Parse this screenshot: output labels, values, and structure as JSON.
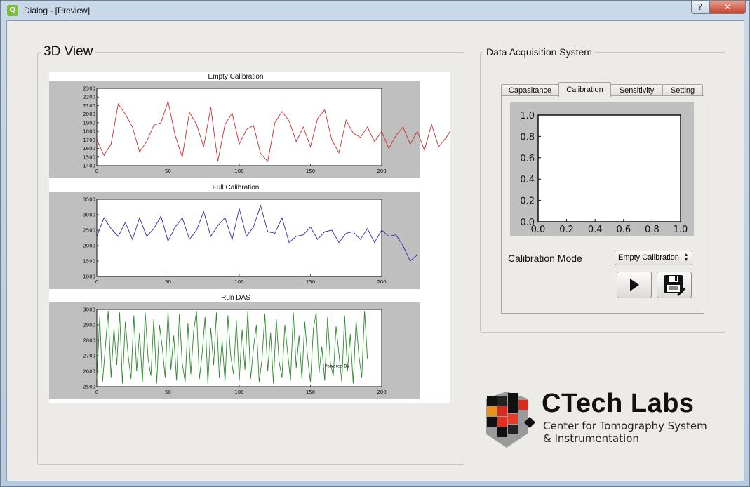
{
  "window": {
    "title": "Dialog - [Preview]",
    "help_glyph": "?",
    "close_glyph": "✕",
    "app_icon_glyph": "Q"
  },
  "view3d": {
    "group_title": "3D View",
    "charts": [
      {
        "title": "Empty Calibration",
        "ytick_labels": [
          "1400",
          "1500",
          "1600",
          "1700",
          "1800",
          "1900",
          "2000",
          "2100",
          "2200",
          "2300"
        ],
        "xtick_labels": [
          "0",
          "50",
          "100",
          "150",
          "200"
        ]
      },
      {
        "title": "Full Calibration",
        "ytick_labels": [
          "1000",
          "1500",
          "2000",
          "2500",
          "3000",
          "3500"
        ],
        "xtick_labels": [
          "0",
          "50",
          "100",
          "150",
          "200"
        ]
      },
      {
        "title": "Run DAS",
        "ytick_labels": [
          "2500",
          "2600",
          "2700",
          "2800",
          "2900",
          "3000"
        ],
        "xtick_labels": [
          "0",
          "50",
          "100",
          "150",
          "200"
        ],
        "annotation": "Powered By"
      }
    ]
  },
  "das": {
    "group_title": "Data Acquisition System",
    "tabs": [
      "Capasitance",
      "Calibration",
      "Sensitivity",
      "Setting"
    ],
    "active_tab": 1,
    "calibration_mode_label": "Calibration Mode",
    "calibration_mode_value": "Empty Calibration",
    "mini_plot": {
      "ytick_labels": [
        "0.0",
        "0.2",
        "0.4",
        "0.6",
        "0.8",
        "1.0"
      ],
      "xtick_labels": [
        "0.0",
        "0.2",
        "0.4",
        "0.6",
        "0.8",
        "1.0"
      ]
    }
  },
  "logo": {
    "title": "CTech Labs",
    "line1": "Center for Tomography System",
    "line2": "& Instrumentation"
  },
  "colors": {
    "empty": "#cc2b2b",
    "full": "#2a2aa6",
    "run": "#2b8a2b",
    "plot_bg": "#bfbfbf"
  },
  "chart_data": [
    {
      "type": "line",
      "title": "Empty Calibration",
      "xlim": [
        0,
        200
      ],
      "ylim": [
        1400,
        2300
      ],
      "x_step": 5,
      "values": [
        1700,
        1520,
        1650,
        2120,
        2000,
        1850,
        1560,
        1680,
        1870,
        1900,
        2150,
        1750,
        1500,
        2020,
        1880,
        1620,
        2080,
        1450,
        1880,
        2010,
        1650,
        1820,
        1870,
        1540,
        1450,
        1900,
        2030,
        1920,
        1680,
        1850,
        1620,
        1950,
        2050,
        1700,
        1550,
        1930,
        1780,
        1730,
        1850,
        1680,
        1800,
        1600,
        1750,
        1850,
        1650,
        1800,
        1580,
        1880,
        1620,
        1720,
        1850,
        1780,
        1550,
        1700
      ]
    },
    {
      "type": "line",
      "title": "Full Calibration",
      "xlim": [
        0,
        200
      ],
      "ylim": [
        1000,
        3500
      ],
      "x_step": 5,
      "values": [
        2300,
        2900,
        2550,
        2300,
        2750,
        2200,
        2900,
        2300,
        2550,
        2950,
        2150,
        2600,
        2900,
        2200,
        2500,
        3100,
        2300,
        2650,
        2900,
        2200,
        3200,
        2300,
        2600,
        3300,
        2450,
        2400,
        2900,
        2100,
        2300,
        2350,
        2600,
        2200,
        2450,
        2500,
        2100,
        2400,
        2450,
        2200,
        2550,
        2100,
        2500,
        2300,
        2350,
        2000,
        1500,
        1700
      ]
    },
    {
      "type": "line",
      "title": "Run DAS",
      "xlim": [
        0,
        200
      ],
      "ylim": [
        2500,
        3000
      ],
      "x_step": 2,
      "values": [
        2550,
        2950,
        2530,
        2760,
        2990,
        2560,
        2880,
        2640,
        2980,
        2520,
        2920,
        2700,
        2550,
        2960,
        2600,
        2850,
        2530,
        2980,
        2680,
        2570,
        2940,
        2520,
        2900,
        2750,
        2560,
        2990,
        2610,
        2830,
        2540,
        2970,
        2650,
        2530,
        2910,
        2580,
        2860,
        2990,
        2550,
        2720,
        2950,
        2520,
        2880,
        2640,
        2980,
        2560,
        2800,
        2530,
        2960,
        2700,
        2580,
        2930,
        2540,
        2870,
        2610,
        2990,
        2550,
        2750,
        2900,
        2530,
        2680,
        2970,
        2600,
        2850,
        2520,
        2940,
        2660,
        2560,
        2900,
        2720,
        2540,
        2980,
        2620,
        2830,
        2550,
        2920,
        2690,
        2530,
        2870,
        2980,
        2590,
        2760,
        2540,
        2950,
        2650,
        2570,
        2890,
        2710,
        2530,
        2960,
        2600,
        2840,
        2520,
        2930,
        2700,
        2560,
        2990,
        2680
      ]
    }
  ]
}
